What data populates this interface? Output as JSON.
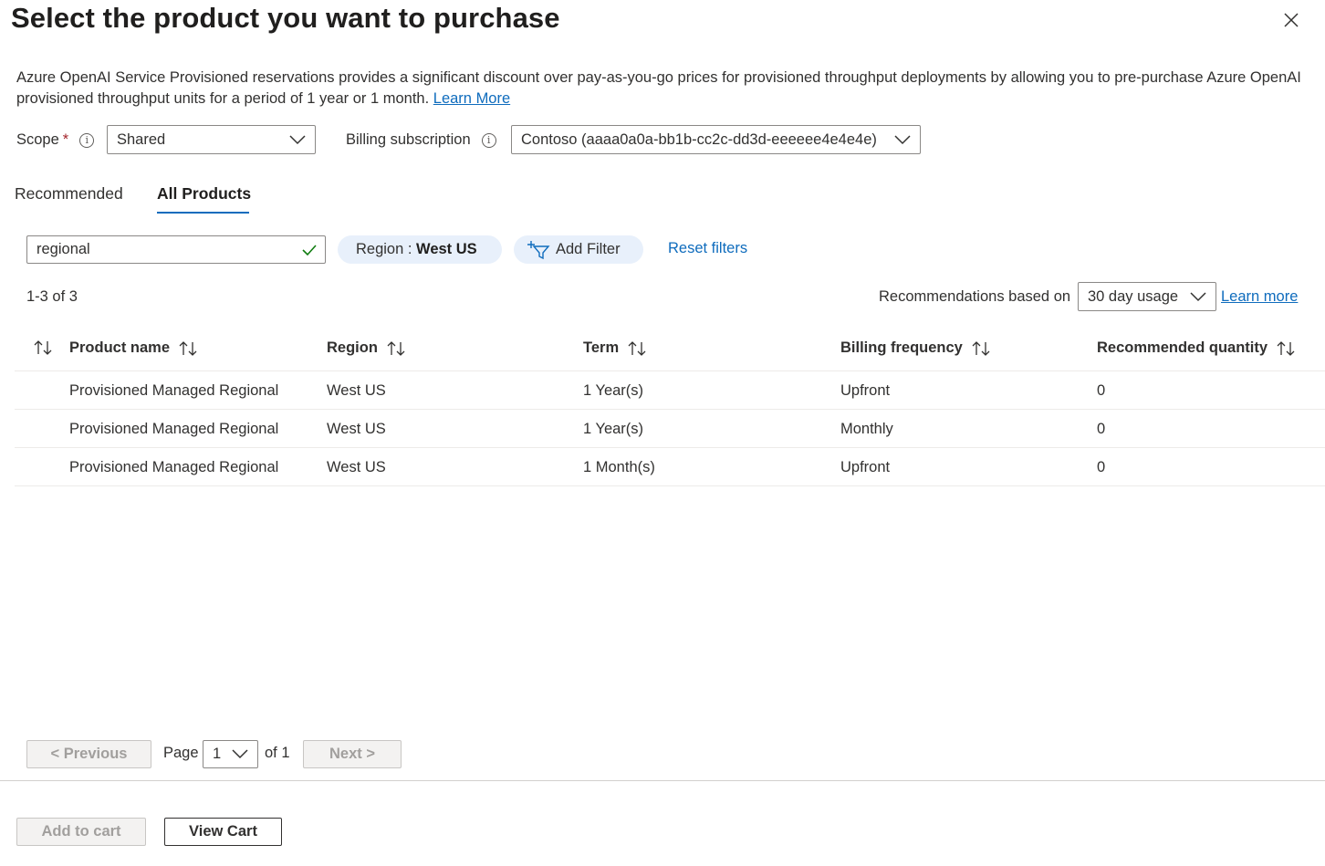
{
  "header": {
    "title": "Select the product you want to purchase",
    "description": "Azure OpenAI Service Provisioned reservations provides a significant discount over pay-as-you-go prices for provisioned throughput deployments by allowing you to pre-purchase Azure OpenAI provisioned throughput units for a period of 1 year or 1 month.",
    "learn_more": "Learn More"
  },
  "scope": {
    "label": "Scope",
    "required_marker": "*",
    "value": "Shared"
  },
  "billing": {
    "label": "Billing subscription",
    "value": "Contoso (aaaa0a0a-bb1b-cc2c-dd3d-eeeeee4e4e4e)"
  },
  "tabs": [
    {
      "label": "Recommended",
      "active": false
    },
    {
      "label": "All Products",
      "active": true
    }
  ],
  "filters": {
    "search_value": "regional",
    "region_pill_key": "Region : ",
    "region_pill_value": "West US",
    "add_filter": "Add Filter",
    "reset": "Reset filters"
  },
  "results": {
    "count": "1-3 of 3",
    "recommendations_label": "Recommendations based on",
    "recommendations_value": "30 day usage",
    "learn_more": "Learn more"
  },
  "table": {
    "columns": [
      "Product name",
      "Region",
      "Term",
      "Billing frequency",
      "Recommended quantity"
    ],
    "rows": [
      [
        "Provisioned Managed Regional",
        "West US",
        "1 Year(s)",
        "Upfront",
        "0"
      ],
      [
        "Provisioned Managed Regional",
        "West US",
        "1 Year(s)",
        "Monthly",
        "0"
      ],
      [
        "Provisioned Managed Regional",
        "West US",
        "1 Month(s)",
        "Upfront",
        "0"
      ]
    ]
  },
  "pagination": {
    "previous": "< Previous",
    "page_label": "Page",
    "page_value": "1",
    "of_label": "of 1",
    "next": "Next >"
  },
  "footer": {
    "add_to_cart": "Add to cart",
    "view_cart": "View Cart"
  },
  "colors": {
    "accent": "#0f6cbd",
    "required": "#a4262c",
    "pill_bg": "#e8f0fb",
    "success_check": "#107c10"
  }
}
